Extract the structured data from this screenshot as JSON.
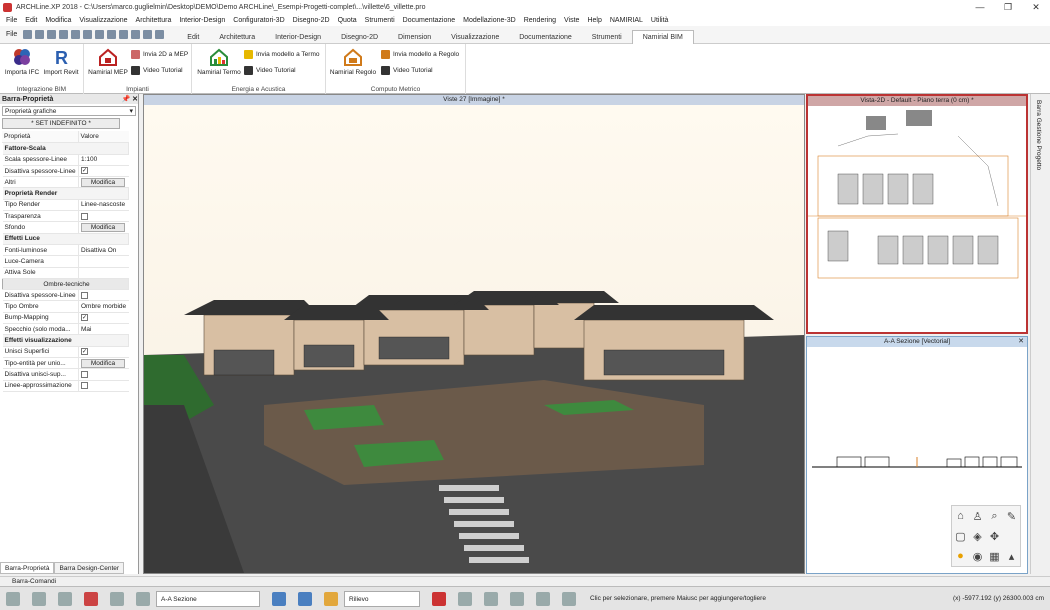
{
  "window": {
    "title": "ARCHLine.XP 2018 - C:\\Users\\marco.guglielmin\\Desktop\\DEMO\\Demo ARCHLine\\_Esempi-Progetti-complet\\...\\villette\\6_villette.pro",
    "controls": [
      "—",
      "❐",
      "✕"
    ]
  },
  "menu": [
    "File",
    "Edit",
    "Modifica",
    "Visualizzazione",
    "Architettura",
    "Interior-Design",
    "Configuratori-3D",
    "Disegno-2D",
    "Quota",
    "Strumenti",
    "Documentazione",
    "Modellazione-3D",
    "Rendering",
    "Viste",
    "Help",
    "NAMIRIAL",
    "Utilità"
  ],
  "ribbon_tabs": {
    "file": "File",
    "items": [
      "Edit",
      "Architettura",
      "Interior-Design",
      "Disegno-2D",
      "Dimension",
      "Visualizzazione",
      "Documentazione",
      "Strumenti",
      "Namirial BIM"
    ],
    "active": "Namirial BIM"
  },
  "ribbon": {
    "integrazione": {
      "label": "Integrazione BIM",
      "import_ifc": "Importa IFC",
      "import_revit": "Import Revit"
    },
    "impianti": {
      "label": "Impianti",
      "mep": "Namirial MEP",
      "send": "Invia 2D a MEP",
      "video": "Video Tutorial"
    },
    "energia": {
      "label": "Energia e Acustica",
      "termo": "Namirial Termo",
      "send": "Invia modello a Termo",
      "video": "Video Tutorial"
    },
    "computo": {
      "label": "Computo Metrico",
      "regolo": "Namirial Regolo",
      "send": "Invia modello a Regolo",
      "video": "Video Tutorial"
    }
  },
  "left_panel": {
    "title": "Barra-Proprietà",
    "pin": "📌 ✕",
    "select": "Proprietà grafiche",
    "set_button": "* SET INDEFINITO *",
    "header": {
      "prop": "Proprietà",
      "val": "Valore"
    },
    "rows": [
      {
        "type": "section",
        "label": "Fattore-Scala"
      },
      {
        "type": "select",
        "label": "Scala spessore-Linee",
        "value": "1:100"
      },
      {
        "type": "check",
        "label": "Disattiva spessore-Linee",
        "value": "✓"
      },
      {
        "type": "button",
        "label": "Altri",
        "value": "Modifica"
      },
      {
        "type": "section",
        "label": "Proprietà Render"
      },
      {
        "type": "select",
        "label": "Tipo Render",
        "value": "Linee-nascoste"
      },
      {
        "type": "check",
        "label": "Trasparenza",
        "value": ""
      },
      {
        "type": "button",
        "label": "Sfondo",
        "value": "Modifica"
      },
      {
        "type": "section",
        "label": "Effetti Luce"
      },
      {
        "type": "select",
        "label": "Fonti-luminose",
        "value": "Disattiva On"
      },
      {
        "type": "select",
        "label": "Luce-Camera",
        "value": ""
      },
      {
        "type": "select",
        "label": "Attiva Sole",
        "value": ""
      },
      {
        "type": "full",
        "label": "Ombre-tecniche"
      },
      {
        "type": "check",
        "label": "Disattiva spessore-Linee",
        "value": ""
      },
      {
        "type": "select",
        "label": "Tipo Ombre",
        "value": "Ombre morbide"
      },
      {
        "type": "check",
        "label": "Bump-Mapping",
        "value": "✓"
      },
      {
        "type": "select",
        "label": "Specchio (solo moda...",
        "value": "Mai"
      },
      {
        "type": "section",
        "label": "Effetti visualizzazione"
      },
      {
        "type": "check",
        "label": "Unisci Superfici",
        "value": "✓"
      },
      {
        "type": "button",
        "label": "Tipo-entità per unio...",
        "value": "Modifica"
      },
      {
        "type": "check",
        "label": "Disattiva unisci-sup...",
        "value": ""
      },
      {
        "type": "check",
        "label": "Linee-approssimazione",
        "value": ""
      }
    ],
    "bottom_tabs": [
      "Barra-Proprietà",
      "Barra Design-Center"
    ]
  },
  "viewport": {
    "title": "Viste 27 [Immagine] *"
  },
  "view2d": {
    "title": "Vista-2D - Default - Piano terra (0 cm) *"
  },
  "section_view": {
    "title": "A-A Sezione [Vectorial]",
    "close": "✕"
  },
  "right_panel": {
    "label": "Barra Gestione Progetto"
  },
  "cmdbar": {
    "label": "Barra-Comandi"
  },
  "status": {
    "view_select": "A-A Sezione",
    "rilievo": "Rilievo",
    "message": "Clic per selezionare, premere Maiusc per aggiungere/togliere",
    "coords": "(x) -5977.192  (y) 26300.003 cm"
  }
}
